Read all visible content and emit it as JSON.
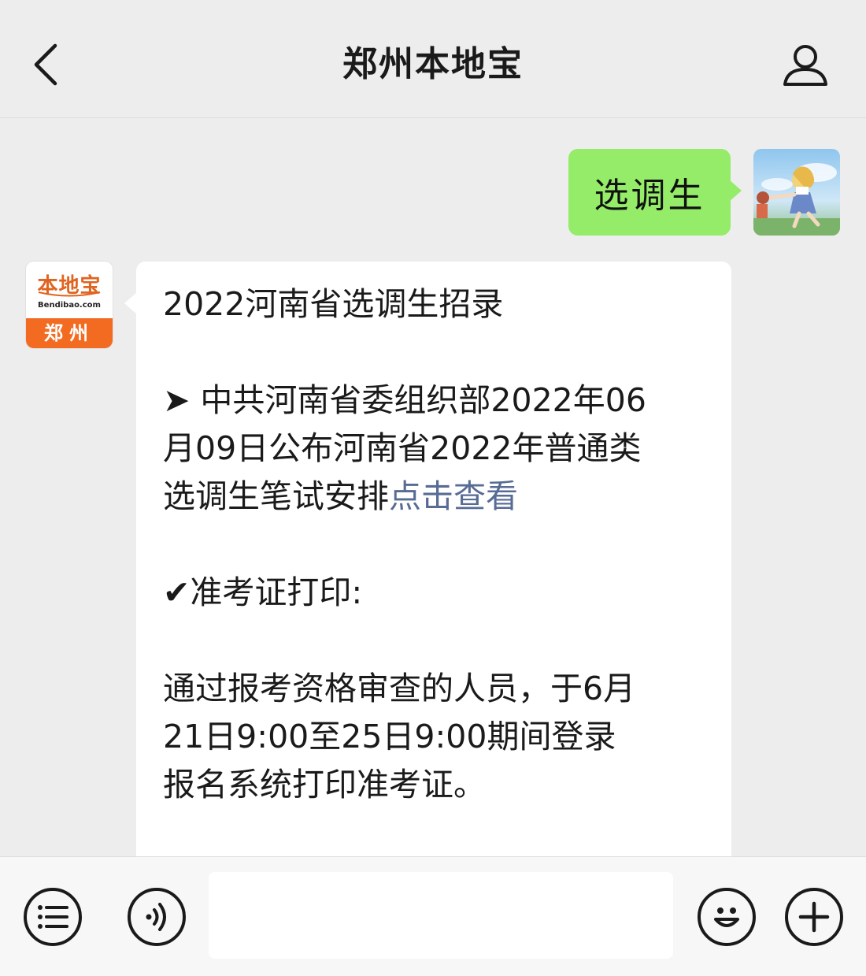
{
  "header": {
    "title": "郑州本地宝"
  },
  "chat": {
    "outgoing": {
      "text": "选调生"
    },
    "bot_avatar": {
      "logo_text": "本地宝",
      "logo_url": "Bendibao.com",
      "city": "郑州"
    },
    "incoming": {
      "title": "2022河南省选调生招录",
      "item1_prefix": "➤",
      "item1_line1": "中共河南省委组织部2022年06",
      "item1_line2": "月09日公布河南省2022年普通类",
      "item1_line3": "选调生笔试安排",
      "item1_link": "点击查看",
      "item2_prefix": "✔",
      "item2_title": "准考证打印:",
      "item2_line1": "通过报考资格审查的人员，于6月",
      "item2_line2": "21日9:00至25日9:00期间登录",
      "item2_line3": "报名系统打印准考证。"
    }
  },
  "input": {
    "placeholder": ""
  },
  "colors": {
    "background": "#ededed",
    "outgoing_bubble": "#95ec69",
    "incoming_bubble": "#ffffff",
    "link": "#576b95",
    "brand_orange": "#f26b21"
  },
  "icons": {
    "back": "chevron-left-icon",
    "profile": "user-icon",
    "menu": "list-icon",
    "voice": "voice-icon",
    "emoji": "emoji-icon",
    "more": "plus-icon"
  }
}
